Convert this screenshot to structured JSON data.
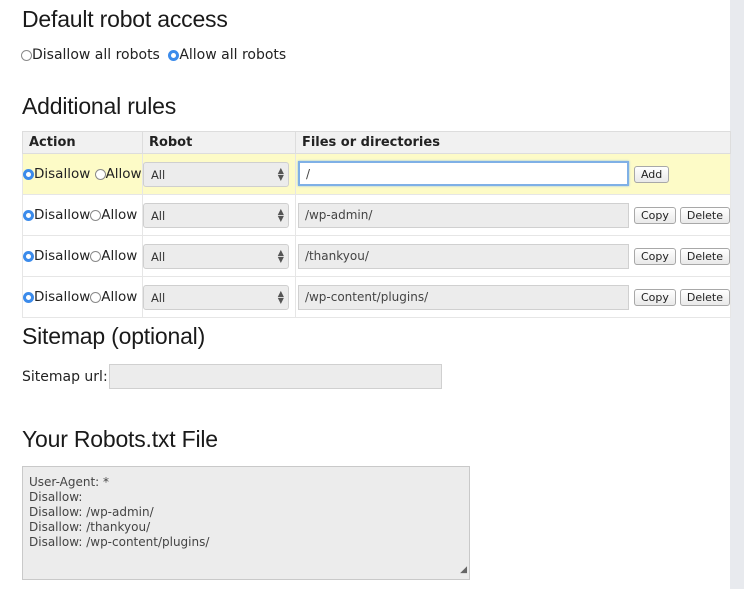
{
  "default_access": {
    "heading": "Default robot access",
    "options": [
      "Disallow all robots",
      "Allow all robots"
    ],
    "selected": "Allow all robots"
  },
  "rules": {
    "heading": "Additional rules",
    "columns": [
      "Action",
      "Robot",
      "Files or directories"
    ],
    "action_labels": [
      "Disallow",
      "Allow"
    ],
    "rows": [
      {
        "action": "Disallow",
        "robot": "All",
        "path": "/",
        "buttons": [
          "Add"
        ]
      },
      {
        "action": "Disallow",
        "robot": "All",
        "path": "/wp-admin/",
        "buttons": [
          "Copy",
          "Delete"
        ]
      },
      {
        "action": "Disallow",
        "robot": "All",
        "path": "/thankyou/",
        "buttons": [
          "Copy",
          "Delete"
        ]
      },
      {
        "action": "Disallow",
        "robot": "All",
        "path": "/wp-content/plugins/",
        "buttons": [
          "Copy",
          "Delete"
        ]
      }
    ]
  },
  "sitemap": {
    "heading": "Sitemap (optional)",
    "label": "Sitemap url:",
    "value": ""
  },
  "robots_file": {
    "heading": "Your Robots.txt File",
    "lines": [
      "User-Agent: *",
      "Disallow:",
      "Disallow: /wp-admin/",
      "Disallow: /thankyou/",
      "Disallow: /wp-content/plugins/"
    ]
  }
}
